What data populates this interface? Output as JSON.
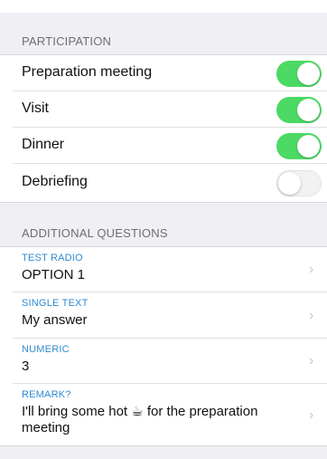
{
  "participation": {
    "header": "PARTICIPATION",
    "items": [
      {
        "label": "Preparation meeting",
        "on": true
      },
      {
        "label": "Visit",
        "on": true
      },
      {
        "label": "Dinner",
        "on": true
      },
      {
        "label": "Debriefing",
        "on": false
      }
    ]
  },
  "additional": {
    "header": "ADDITIONAL QUESTIONS",
    "fields": [
      {
        "title": "TEST RADIO",
        "value": "OPTION 1"
      },
      {
        "title": "SINGLE TEXT",
        "value": "My answer"
      },
      {
        "title": "NUMERIC",
        "value": "3"
      },
      {
        "title": "REMARK?",
        "value": "I'll bring some hot ☕ for the preparation meeting"
      }
    ]
  },
  "icons": {
    "chevron": "chevron-right-icon",
    "toggle_on_color": "#4cd964",
    "toggle_off_color": "#f2f2f2",
    "field_title_color": "#2f8ad0"
  }
}
